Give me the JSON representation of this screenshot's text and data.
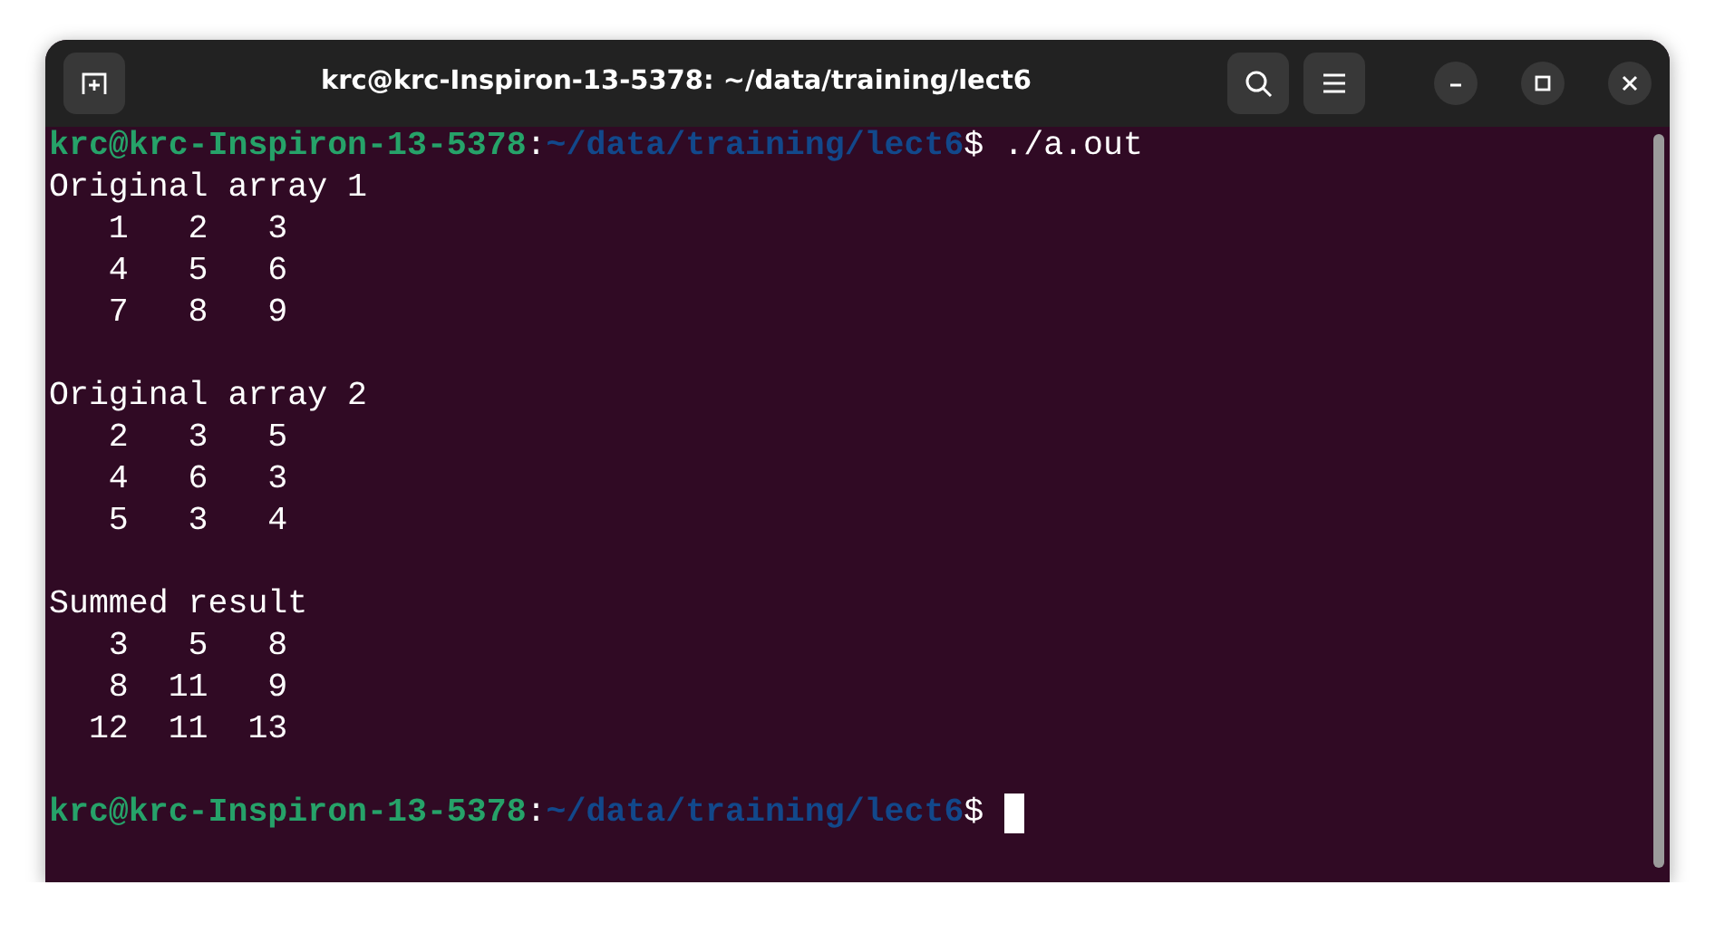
{
  "window": {
    "title": "krc@krc-Inspiron-13-5378: ~/data/training/lect6"
  },
  "lines": [
    {
      "kind": "prompt",
      "user": "krc@krc-Inspiron-13-5378",
      "separator": ":",
      "path": "~/data/training/lect6",
      "symbol": "$",
      "command": " ./a.out"
    },
    {
      "kind": "output",
      "text": "Original array 1"
    },
    {
      "kind": "output",
      "text": "   1   2   3"
    },
    {
      "kind": "output",
      "text": "   4   5   6"
    },
    {
      "kind": "output",
      "text": "   7   8   9"
    },
    {
      "kind": "blank"
    },
    {
      "kind": "output",
      "text": "Original array 2"
    },
    {
      "kind": "output",
      "text": "   2   3   5"
    },
    {
      "kind": "output",
      "text": "   4   6   3"
    },
    {
      "kind": "output",
      "text": "   5   3   4"
    },
    {
      "kind": "blank"
    },
    {
      "kind": "output",
      "text": "Summed result"
    },
    {
      "kind": "output",
      "text": "   3   5   8"
    },
    {
      "kind": "output",
      "text": "   8  11   9"
    },
    {
      "kind": "output",
      "text": "  12  11  13"
    },
    {
      "kind": "blank"
    },
    {
      "kind": "prompt",
      "user": "krc@krc-Inspiron-13-5378",
      "separator": ":",
      "path": "~/data/training/lect6",
      "symbol": "$",
      "cursor": true
    }
  ]
}
